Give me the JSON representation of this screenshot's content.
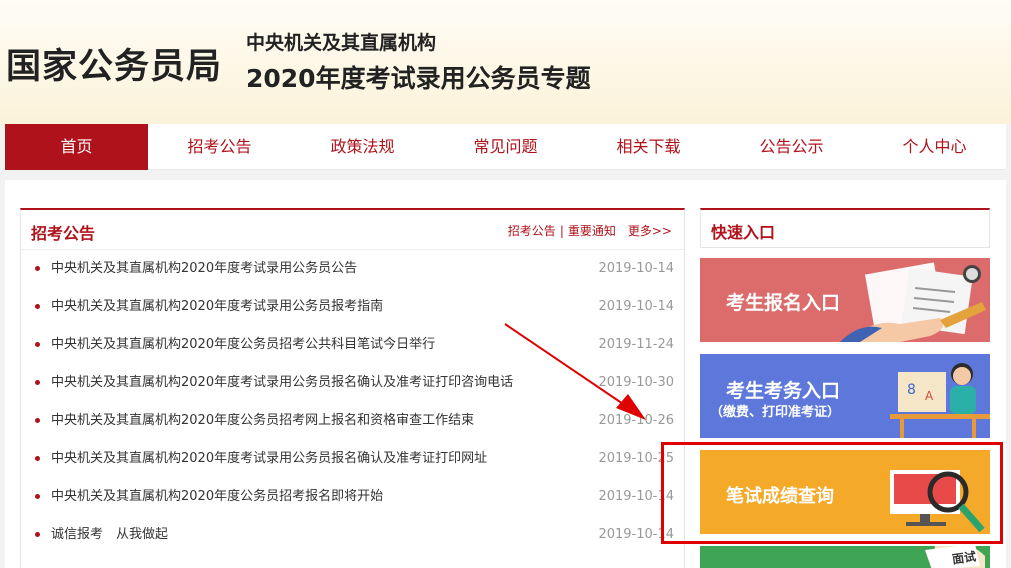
{
  "header": {
    "brand": "国家公务员局",
    "subtitle1": "中央机关及其直属机构",
    "subtitle2": "2020年度考试录用公务员专题"
  },
  "nav": {
    "items": [
      "首页",
      "招考公告",
      "政策法规",
      "常见问题",
      "相关下载",
      "公告公示",
      "个人中心"
    ]
  },
  "notice": {
    "title": "招考公告",
    "link1": "招考公告",
    "sep": "|",
    "link2": "重要通知",
    "more": "更多>>",
    "items": [
      {
        "text": "中央机关及其直属机构2020年度考试录用公务员公告",
        "date": "2019-10-14"
      },
      {
        "text": "中央机关及其直属机构2020年度考试录用公务员报考指南",
        "date": "2019-10-14"
      },
      {
        "text": "中央机关及其直属机构2020年度公务员招考公共科目笔试今日举行",
        "date": "2019-11-24"
      },
      {
        "text": "中央机关及其直属机构2020年度考试录用公务员报名确认及准考证打印咨询电话",
        "date": "2019-10-30"
      },
      {
        "text": "中央机关及其直属机构2020年度公务员招考网上报名和资格审查工作结束",
        "date": "2019-10-26"
      },
      {
        "text": "中央机关及其直属机构2020年度考试录用公务员报名确认及准考证打印网址",
        "date": "2019-10-25"
      },
      {
        "text": "中央机关及其直属机构2020年度公务员招考报名即将开始",
        "date": "2019-10-14"
      },
      {
        "text": "诚信报考　从我做起",
        "date": "2019-10-14"
      }
    ]
  },
  "quick": {
    "title": "快速入口",
    "register": "考生报名入口",
    "exam": "考生考务入口",
    "exam_sub": "（缴费、打印准考证）",
    "score": "笔试成绩查询",
    "interview_tag": "面试"
  },
  "colors": {
    "brand_red": "#b0121b",
    "register_bg": "#dc6c6c",
    "exam_bg": "#5d78da",
    "score_bg": "#f5a928",
    "interview_bg": "#3fa555",
    "highlight": "#e00000"
  }
}
